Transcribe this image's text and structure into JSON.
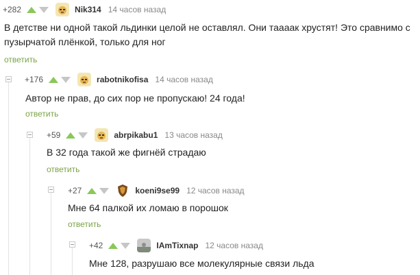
{
  "comments": [
    {
      "rating": "+282",
      "username": "Nik314",
      "time": "14 часов назад",
      "text": "В детстве ни одной такой льдинки целой не оставлял. Они таааак хрустят! Это сравнимо с пузырчатой плёнкой, только для ног",
      "reply": "ответить",
      "avatar": "dog-avatar"
    },
    {
      "rating": "+176",
      "username": "rabotnikofisa",
      "time": "14 часов назад",
      "text": "Автор не прав, до сих пор не пропускаю! 24 года!",
      "reply": "ответить",
      "avatar": "dog-avatar"
    },
    {
      "rating": "+59",
      "username": "abrpikabu1",
      "time": "13 часов назад",
      "text": "В 32 года такой же фигнёй страдаю",
      "reply": "ответить",
      "avatar": "dog-avatar"
    },
    {
      "rating": "+27",
      "username": "koeni9se99",
      "time": "12 часов назад",
      "text": "Мне 64 палкой их ломаю в порошок",
      "reply": "ответить",
      "avatar": "shield-avatar"
    },
    {
      "rating": "+42",
      "username": "IAmTixnap",
      "time": "12 часов назад",
      "text": "Мне 128, разрушаю все молекулярные связи льда",
      "avatar": "photo-avatar"
    }
  ],
  "colors": {
    "upvote": "#8ac858",
    "downvote": "#c6c6c6",
    "reply_link": "#7aa345"
  }
}
